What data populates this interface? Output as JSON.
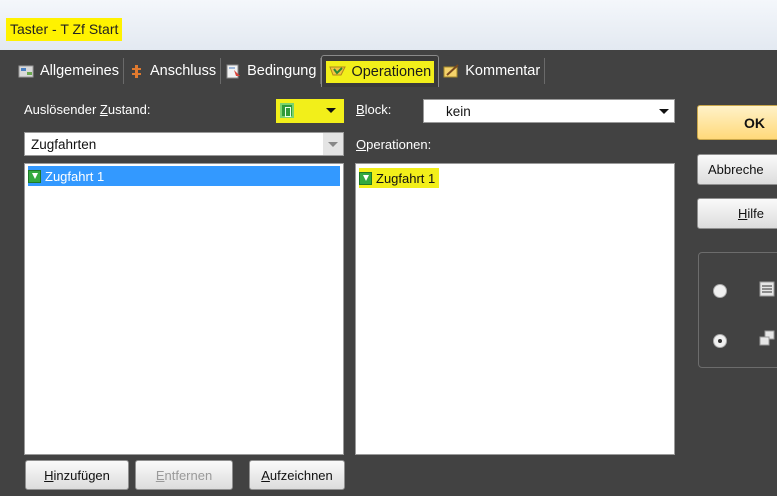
{
  "window": {
    "title": "Taster - T Zf Start"
  },
  "tabs": [
    {
      "label": "Allgemeines",
      "icon": "settings-icon"
    },
    {
      "label": "Anschluss",
      "icon": "connector-icon"
    },
    {
      "label": "Bedingung",
      "icon": "condition-icon"
    },
    {
      "label": "Operationen",
      "icon": "operations-icon",
      "active": true
    },
    {
      "label": "Kommentar",
      "icon": "comment-icon"
    }
  ],
  "left": {
    "state_label_pre": "Auslösender ",
    "state_label_ul": "Z",
    "state_label_post": "ustand:",
    "category": "Zugfahrten",
    "items": [
      "Zugfahrt 1"
    ]
  },
  "right": {
    "block_label_ul": "B",
    "block_label_post": "lock:",
    "block_value": "kein",
    "ops_label_ul": "O",
    "ops_label_post": "perationen:",
    "items": [
      "Zugfahrt 1"
    ]
  },
  "buttons": {
    "add_ul": "H",
    "add_post": "inzufügen",
    "remove_ul": "E",
    "remove_post": "ntfernen",
    "record_ul": "A",
    "record_post": "ufzeichnen",
    "ok": "OK",
    "cancel": "Abbreche",
    "help_ul": "H",
    "help_post": "ilfe"
  },
  "colors": {
    "highlight": "#f2ef1a",
    "selection": "#3399ff",
    "panel": "#424242"
  }
}
